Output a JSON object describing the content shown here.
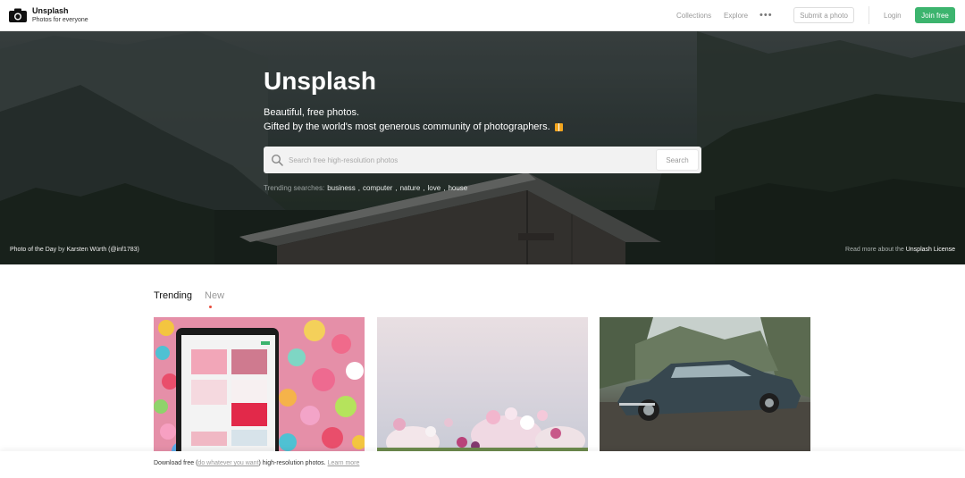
{
  "header": {
    "brand_name": "Unsplash",
    "brand_tagline": "Photos for everyone",
    "nav": {
      "collections": "Collections",
      "explore": "Explore",
      "more": "•••"
    },
    "submit_label": "Submit a photo",
    "login_label": "Login",
    "join_label": "Join free"
  },
  "hero": {
    "title": "Unsplash",
    "subtitle_1": "Beautiful, free photos.",
    "subtitle_2": "Gifted by the world's most generous community of photographers.",
    "search_placeholder": "Search free high-resolution photos",
    "search_button": "Search",
    "trending_label": "Trending searches:",
    "trending": [
      "business",
      "computer",
      "nature",
      "love",
      "house"
    ],
    "credit_prefix": "Photo of the Day",
    "credit_by": "by",
    "credit_author": "Karsten Würth (@inf1783)",
    "license_prefix": "Read more about the",
    "license_link": "Unsplash License"
  },
  "tabs": {
    "trending": "Trending",
    "new": "New"
  },
  "banner": {
    "prefix": "Download free (",
    "link1": "do whatever you want",
    "middle": ") high-resolution photos.",
    "link2": "Learn more"
  },
  "colors": {
    "join_green": "#3cb46e",
    "tab_dot": "#e74c3c"
  }
}
